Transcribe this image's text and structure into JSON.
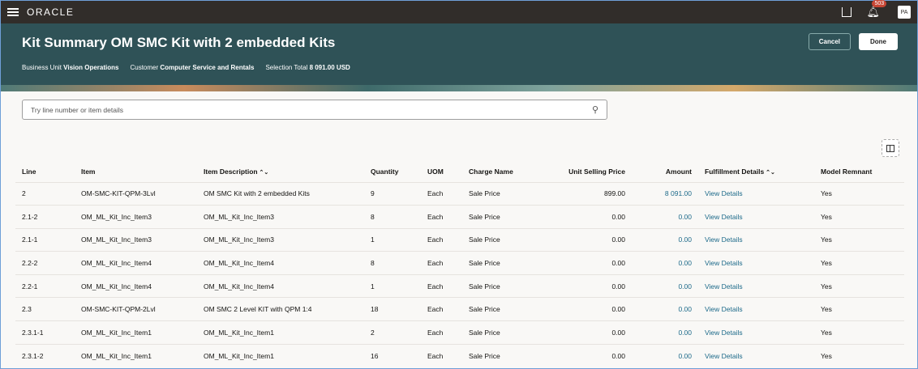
{
  "topbar": {
    "logo": "ORACLE",
    "notification_count": "503",
    "avatar": "PA"
  },
  "header": {
    "title": "Kit Summary OM SMC Kit with 2 embedded Kits",
    "meta": [
      {
        "label": "Business Unit",
        "value": "Vision Operations"
      },
      {
        "label": "Customer",
        "value": "Computer Service and Rentals"
      },
      {
        "label": "Selection Total",
        "value": "8 091.00 USD"
      }
    ],
    "cancel": "Cancel",
    "done": "Done"
  },
  "search": {
    "placeholder": "Try line number or item details"
  },
  "table": {
    "columns": [
      "Line",
      "Item",
      "Item Description",
      "Quantity",
      "UOM",
      "Charge Name",
      "Unit Selling Price",
      "Amount",
      "Fulfillment Details",
      "Model Remnant"
    ],
    "rows": [
      [
        "2",
        "OM-SMC-KIT-QPM-3Lvl",
        "OM SMC Kit with 2 embedded Kits",
        "9",
        "Each",
        "Sale Price",
        "899.00",
        "8 091.00",
        "View Details",
        "Yes"
      ],
      [
        "2.1-2",
        "OM_ML_Kit_Inc_Item3",
        "OM_ML_Kit_Inc_Item3",
        "8",
        "Each",
        "Sale Price",
        "0.00",
        "0.00",
        "View Details",
        "Yes"
      ],
      [
        "2.1-1",
        "OM_ML_Kit_Inc_Item3",
        "OM_ML_Kit_Inc_Item3",
        "1",
        "Each",
        "Sale Price",
        "0.00",
        "0.00",
        "View Details",
        "Yes"
      ],
      [
        "2.2-2",
        "OM_ML_Kit_Inc_Item4",
        "OM_ML_Kit_Inc_Item4",
        "8",
        "Each",
        "Sale Price",
        "0.00",
        "0.00",
        "View Details",
        "Yes"
      ],
      [
        "2.2-1",
        "OM_ML_Kit_Inc_Item4",
        "OM_ML_Kit_Inc_Item4",
        "1",
        "Each",
        "Sale Price",
        "0.00",
        "0.00",
        "View Details",
        "Yes"
      ],
      [
        "2.3",
        "OM-SMC-KIT-QPM-2Lvl",
        "OM SMC 2 Level KIT with QPM 1:4",
        "18",
        "Each",
        "Sale Price",
        "0.00",
        "0.00",
        "View Details",
        "Yes"
      ],
      [
        "2.3.1-1",
        "OM_ML_Kit_Inc_Item1",
        "OM_ML_Kit_Inc_Item1",
        "2",
        "Each",
        "Sale Price",
        "0.00",
        "0.00",
        "View Details",
        "Yes"
      ],
      [
        "2.3.1-2",
        "OM_ML_Kit_Inc_Item1",
        "OM_ML_Kit_Inc_Item1",
        "16",
        "Each",
        "Sale Price",
        "0.00",
        "0.00",
        "View Details",
        "Yes"
      ]
    ]
  }
}
